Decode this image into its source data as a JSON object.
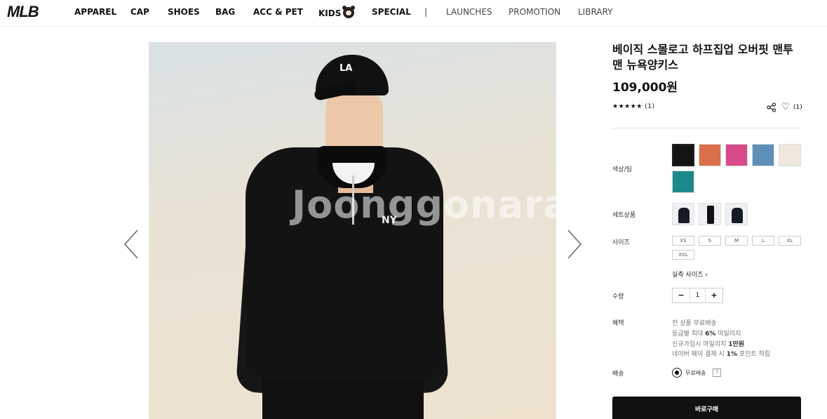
{
  "header": {
    "logo": "MLB",
    "nav": [
      "APPAREL",
      "CAP",
      "SHOES",
      "BAG",
      "ACC & PET",
      "KIDS",
      "SPECIAL"
    ],
    "separator": "|",
    "nav_secondary": [
      "LAUNCHES",
      "PROMOTION",
      "LIBRARY"
    ]
  },
  "gallery": {
    "watermark": "Joonggonara",
    "cap_logo": "LA",
    "chest_logo": "NY"
  },
  "product": {
    "title": "베이직 스몰로고 하프집업 오버핏 맨투맨 뉴욕양키스",
    "price": "109,000원",
    "stars": "★★★★★",
    "review_count": "(1)",
    "like_count": "(1)"
  },
  "options": {
    "color_label": "색상/팀",
    "colors": [
      "#141414",
      "#d9704a",
      "#d84b8a",
      "#5e8fb8",
      "#efe9dd",
      "#1c8a8a"
    ],
    "set_label": "세트상품",
    "size_label": "사이즈",
    "sizes": [
      "XS",
      "S",
      "M",
      "L",
      "XL",
      "XXL"
    ],
    "size_guide": "실측 사이즈",
    "qty_label": "수량",
    "qty_value": "1",
    "qty_minus": "−",
    "qty_plus": "+",
    "benefit_label": "혜택",
    "benefits": {
      "line1": "전 상품 무료배송",
      "line2_pre": "등급별 최대 ",
      "line2_bold": "6%",
      "line2_post": " 마일리지",
      "line3_pre": "신규가입시 마일리지 ",
      "line3_bold": "1만원",
      "line4_pre": "네이버 페이 결제 시 ",
      "line4_bold": "1%",
      "line4_post": " 포인트 적립"
    },
    "shipping_label": "배송",
    "shipping_option": "무료배송",
    "shipping_help": "?"
  },
  "buy_button": "바로구매"
}
